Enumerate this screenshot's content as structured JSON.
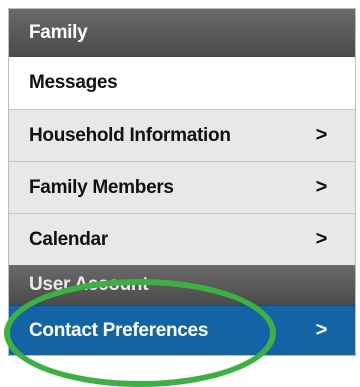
{
  "menu": {
    "family_header": "Family",
    "items": [
      {
        "label": "Messages",
        "chevron": ""
      },
      {
        "label": "Household Information",
        "chevron": ">"
      },
      {
        "label": "Family Members",
        "chevron": ">"
      },
      {
        "label": "Calendar",
        "chevron": ">"
      }
    ],
    "user_header": "User Account",
    "active_item": {
      "label": "Contact Preferences",
      "chevron": ">"
    }
  },
  "colors": {
    "header_bg": "#555555",
    "item_bg": "#e8e8e8",
    "active_bg": "#1464a5",
    "highlight_ring": "#3cb043"
  }
}
